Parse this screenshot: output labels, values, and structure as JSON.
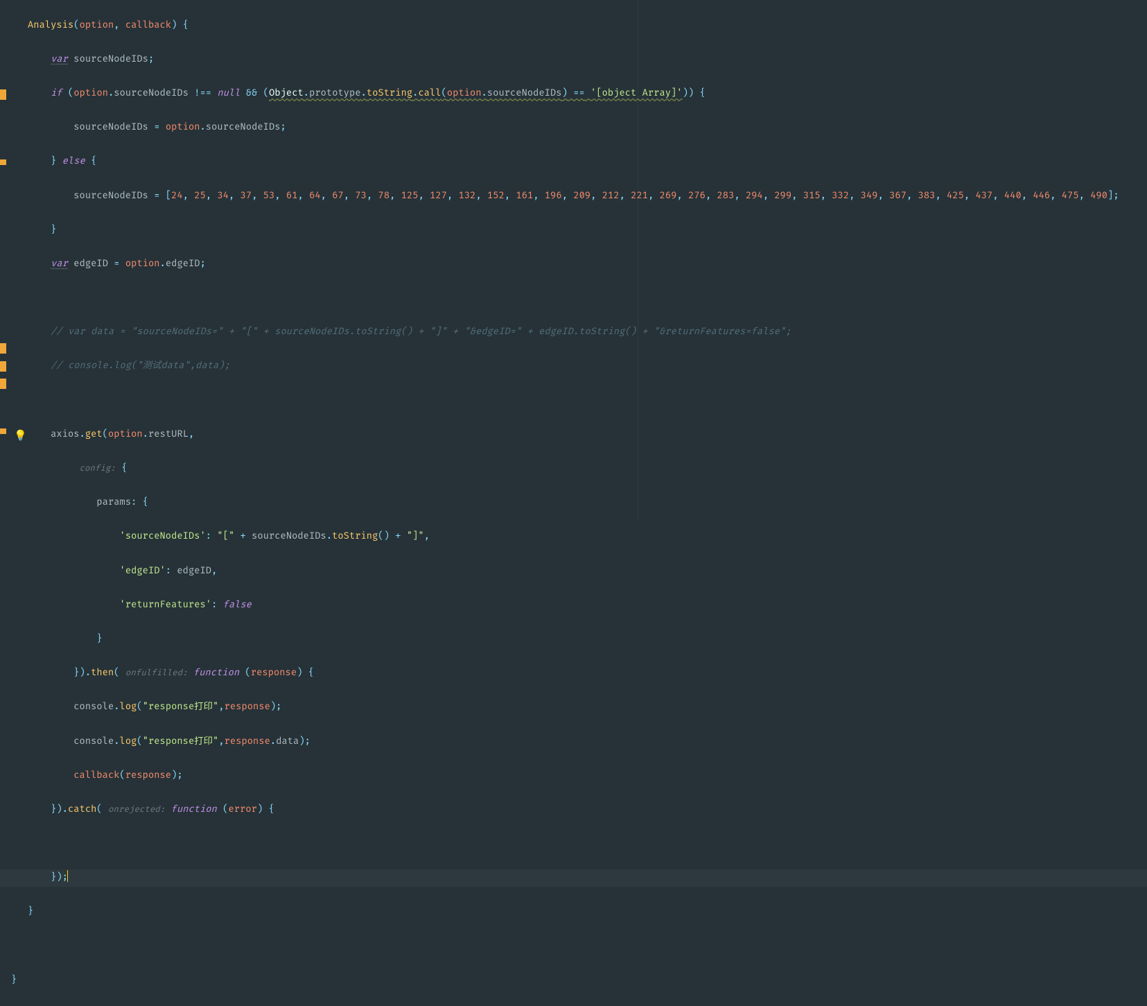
{
  "fn_name": "Analysis",
  "param_option": "option",
  "param_callback": "callback",
  "kw": {
    "var": "var",
    "if": "if",
    "null": "null",
    "else": "else",
    "function": "function",
    "false": "false"
  },
  "ids": {
    "sourceNodeIDs": "sourceNodeIDs",
    "edgeID": "edgeID",
    "Object": "Object",
    "prototype": "prototype",
    "toString": "toString",
    "call": "call",
    "axios": "axios",
    "get": "get",
    "restURL": "restURL",
    "config": "config:",
    "params": "params",
    "returnFeatures": "returnFeatures",
    "then": "then",
    "onfulfilled": "onfulfilled:",
    "response": "response",
    "console": "console",
    "log": "log",
    "data": "data",
    "catch": "catch",
    "onrejected": "onrejected:",
    "error": "error"
  },
  "arr_literal": "'[object Array]'",
  "numbers": [
    24,
    25,
    34,
    37,
    53,
    61,
    64,
    67,
    73,
    78,
    125,
    127,
    132,
    152,
    161,
    196,
    209,
    212,
    221,
    269,
    276,
    283,
    294,
    299,
    315,
    332,
    349,
    367,
    383,
    425,
    437,
    440,
    446,
    475,
    490
  ],
  "comments": {
    "c1": "// var data = \"sourceNodeIDs=\" + \"[\" + sourceNodeIDs.toString() + \"]\" + \"&edgeID=\" + edgeID.toString() + \"&returnFeatures=false\";",
    "c2": "// console.log(\"测试data\",data);"
  },
  "strings": {
    "sourceNodeIDs_key": "'sourceNodeIDs'",
    "open_br": "\"[\"",
    "close_br": "\"]\"",
    "edgeID_key": "'edgeID'",
    "returnFeatures_key": "'returnFeatures'",
    "resp_print": "\"response打印\""
  }
}
